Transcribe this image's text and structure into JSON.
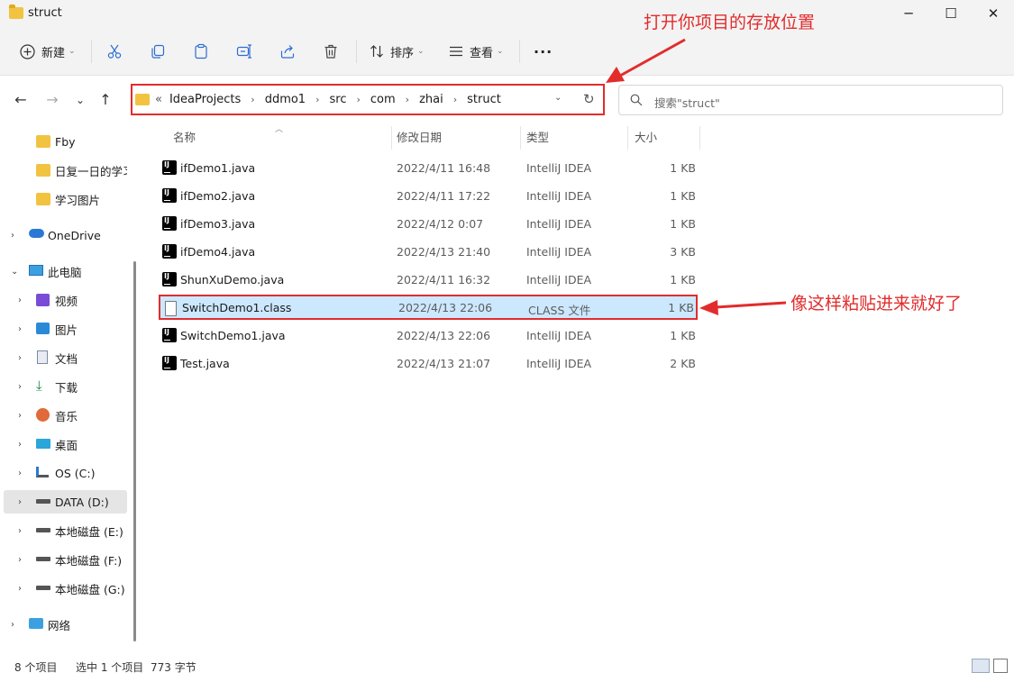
{
  "window": {
    "title": "struct",
    "minimize": "─",
    "maximize": "☐",
    "close": "✕"
  },
  "toolbar": {
    "new_label": "新建",
    "sort_label": "排序",
    "view_label": "查看",
    "more_label": "···"
  },
  "address": {
    "overflow": "«",
    "crumbs": [
      "IdeaProjects",
      "ddmo1",
      "src",
      "com",
      "zhai",
      "struct"
    ]
  },
  "search": {
    "placeholder": "搜索\"struct\""
  },
  "sidebar": {
    "items": [
      {
        "label": "Fby"
      },
      {
        "label": "日复一日的学习"
      },
      {
        "label": "学习图片"
      },
      {
        "label": "OneDrive"
      },
      {
        "label": "此电脑"
      },
      {
        "label": "视频"
      },
      {
        "label": "图片"
      },
      {
        "label": "文档"
      },
      {
        "label": "下载"
      },
      {
        "label": "音乐"
      },
      {
        "label": "桌面"
      },
      {
        "label": "OS (C:)"
      },
      {
        "label": "DATA (D:)"
      },
      {
        "label": "本地磁盘 (E:)"
      },
      {
        "label": "本地磁盘 (F:)"
      },
      {
        "label": "本地磁盘 (G:)"
      },
      {
        "label": "网络"
      }
    ]
  },
  "columns": {
    "name": "名称",
    "date": "修改日期",
    "type": "类型",
    "size": "大小"
  },
  "files": [
    {
      "name": "ifDemo1.java",
      "date": "2022/4/11 16:48",
      "type": "IntelliJ IDEA",
      "size": "1 KB"
    },
    {
      "name": "ifDemo2.java",
      "date": "2022/4/11 17:22",
      "type": "IntelliJ IDEA",
      "size": "1 KB"
    },
    {
      "name": "ifDemo3.java",
      "date": "2022/4/12 0:07",
      "type": "IntelliJ IDEA",
      "size": "1 KB"
    },
    {
      "name": "ifDemo4.java",
      "date": "2022/4/13 21:40",
      "type": "IntelliJ IDEA",
      "size": "3 KB"
    },
    {
      "name": "ShunXuDemo.java",
      "date": "2022/4/11 16:32",
      "type": "IntelliJ IDEA",
      "size": "1 KB"
    },
    {
      "name": "SwitchDemo1.class",
      "date": "2022/4/13 22:06",
      "type": "CLASS 文件",
      "size": "1 KB"
    },
    {
      "name": "SwitchDemo1.java",
      "date": "2022/4/13 22:06",
      "type": "IntelliJ IDEA",
      "size": "1 KB"
    },
    {
      "name": "Test.java",
      "date": "2022/4/13 21:07",
      "type": "IntelliJ IDEA",
      "size": "2 KB"
    }
  ],
  "annotations": {
    "top": "打开你项目的存放位置",
    "right": "像这样粘贴进来就好了"
  },
  "status": {
    "count": "8 个项目",
    "selection": "选中 1 个项目",
    "bytes": "773 字节"
  },
  "colors": {
    "annotation": "#e22c2c",
    "selection": "#cce8ff"
  }
}
